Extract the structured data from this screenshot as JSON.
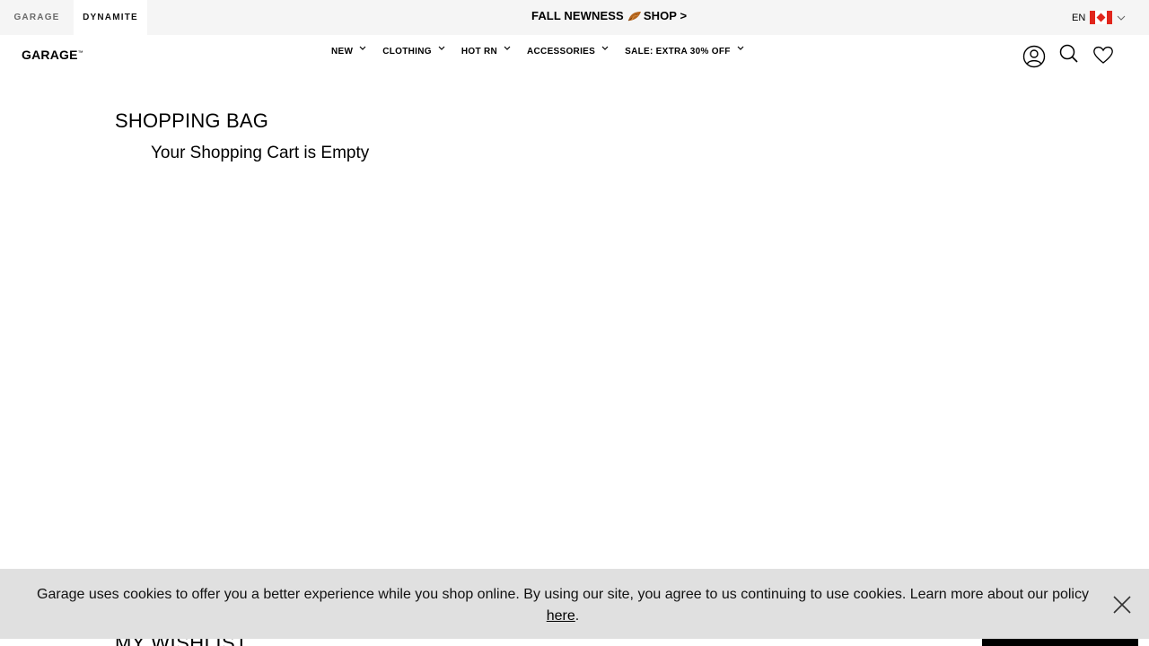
{
  "topbar": {
    "brands": [
      "GARAGE",
      "DYNAMITE"
    ],
    "promo_text": "FALL NEWNESS",
    "promo_link": "SHOP >",
    "language": "EN",
    "flag_icon": "canada-flag-icon"
  },
  "header": {
    "logo": "GARAGE",
    "nav": [
      "NEW",
      "CLOTHING",
      "HOT RN",
      "ACCESSORIES",
      "SALE: EXTRA 30% OFF"
    ],
    "icons": [
      "account-icon",
      "search-icon",
      "heart-icon"
    ]
  },
  "main": {
    "title": "SHOPPING BAG",
    "empty_message": "Your Shopping Cart is Empty",
    "wishlist_title": "MY WISHLIST"
  },
  "cookie": {
    "text": "Garage uses cookies to offer you a better experience while you shop online. By using our site, you agree to us continuing to use cookies. Learn more about our policy",
    "link_text": "here",
    "trailing": "."
  },
  "colors": {
    "topbar_bg": "#f5f5f5",
    "cookie_bg": "#e0e0e0",
    "flag_red": "#e1261c",
    "leaf": "#b5651d"
  }
}
